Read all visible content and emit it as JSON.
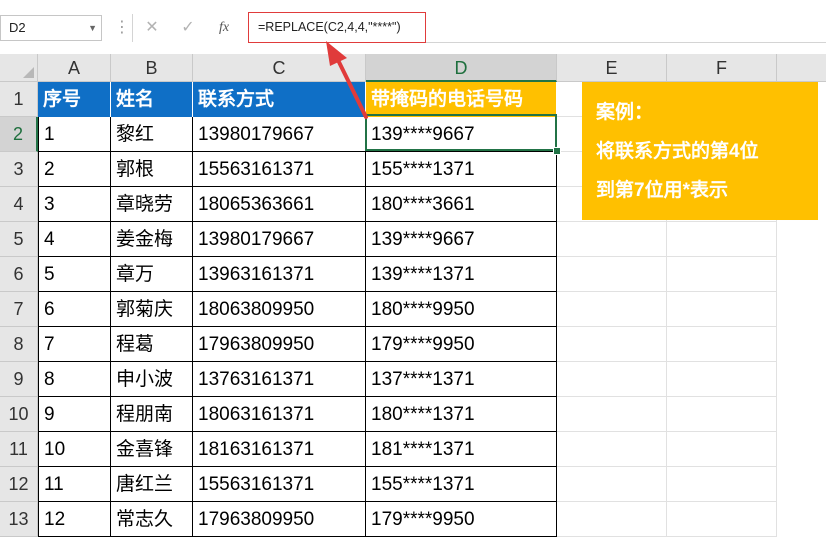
{
  "formula_bar": {
    "name_box": "D2",
    "cancel_symbol": "✕",
    "enter_symbol": "✓",
    "fx_label": "fx",
    "formula": "=REPLACE(C2,4,4,\"****\")"
  },
  "columns": [
    "A",
    "B",
    "C",
    "D",
    "E",
    "F"
  ],
  "rows": [
    "1",
    "2",
    "3",
    "4",
    "5",
    "6",
    "7",
    "8",
    "9",
    "10",
    "11",
    "12",
    "13"
  ],
  "table": {
    "headers": [
      "序号",
      "姓名",
      "联系方式",
      "带掩码的电话号码"
    ],
    "records": [
      [
        "1",
        "黎红",
        "13980179667",
        "139****9667"
      ],
      [
        "2",
        "郭根",
        "15563161371",
        "155****1371"
      ],
      [
        "3",
        "章晓劳",
        "18065363661",
        "180****3661"
      ],
      [
        "4",
        "姜金梅",
        "13980179667",
        "139****9667"
      ],
      [
        "5",
        "章万",
        "13963161371",
        "139****1371"
      ],
      [
        "6",
        "郭菊庆",
        "18063809950",
        "180****9950"
      ],
      [
        "7",
        "程葛",
        "17963809950",
        "179****9950"
      ],
      [
        "8",
        "申小波",
        "13763161371",
        "137****1371"
      ],
      [
        "9",
        "程朋南",
        "18063161371",
        "180****1371"
      ],
      [
        "10",
        "金喜锋",
        "18163161371",
        "181****1371"
      ],
      [
        "11",
        "唐红兰",
        "15563161371",
        "155****1371"
      ],
      [
        "12",
        "常志久",
        "17963809950",
        "179****9950"
      ]
    ]
  },
  "callout": {
    "lines": [
      "案例：",
      "将联系方式的第4位",
      "到第7位用*表示"
    ]
  },
  "colors": {
    "header_blue": "#0f6fc6",
    "header_gold": "#ffc000",
    "selection_green": "#217346",
    "arrow_red": "#e03b3b"
  }
}
